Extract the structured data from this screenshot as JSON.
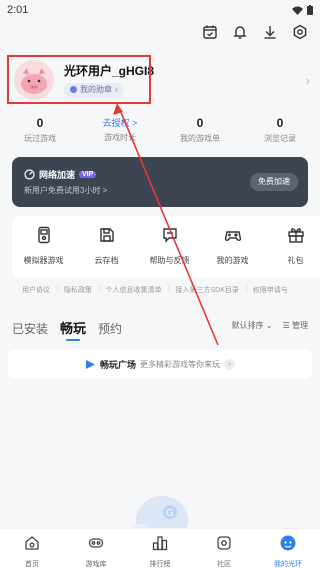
{
  "status": {
    "time": "2:01"
  },
  "profile": {
    "username": "光环用户_gHGI8",
    "badge": "我的勋章"
  },
  "stats": [
    {
      "num": "0",
      "label": "玩过游戏"
    },
    {
      "num": "去授权 >",
      "label": "游戏时长"
    },
    {
      "num": "0",
      "label": "我的游戏单"
    },
    {
      "num": "0",
      "label": "浏览记录"
    }
  ],
  "net": {
    "title": "网络加速",
    "vip": "VIP",
    "sub": "新用户免费试用3小时 >",
    "button": "免费加速"
  },
  "tools": [
    {
      "label": "模拟器游戏",
      "icon": "gamepad-device-icon"
    },
    {
      "label": "云存档",
      "icon": "cloud-save-icon"
    },
    {
      "label": "帮助与反馈",
      "icon": "feedback-icon"
    },
    {
      "label": "我的游戏",
      "icon": "controller-icon"
    },
    {
      "label": "礼包",
      "icon": "gift-icon"
    }
  ],
  "links": [
    "用户协议",
    "隐私政策",
    "个人信息收集清单",
    "接入第三方SDK目录",
    "权限申请与"
  ],
  "tabs": [
    {
      "label": "已安装"
    },
    {
      "label": "畅玩"
    },
    {
      "label": "预约"
    }
  ],
  "sort": {
    "label": "默认排序",
    "manage": "管理"
  },
  "banner": {
    "title": "畅玩广场",
    "sub": "更多精彩游戏等你来玩"
  },
  "nav": [
    {
      "label": "首页",
      "icon": "home-icon"
    },
    {
      "label": "游戏库",
      "icon": "game-library-icon"
    },
    {
      "label": "排行榜",
      "icon": "ranking-icon"
    },
    {
      "label": "社区",
      "icon": "community-icon"
    },
    {
      "label": "我的光环",
      "icon": "my-halo-icon"
    }
  ],
  "colors": {
    "accent": "#2f80ed",
    "annotation": "#e53935",
    "card": "#3d4452"
  }
}
